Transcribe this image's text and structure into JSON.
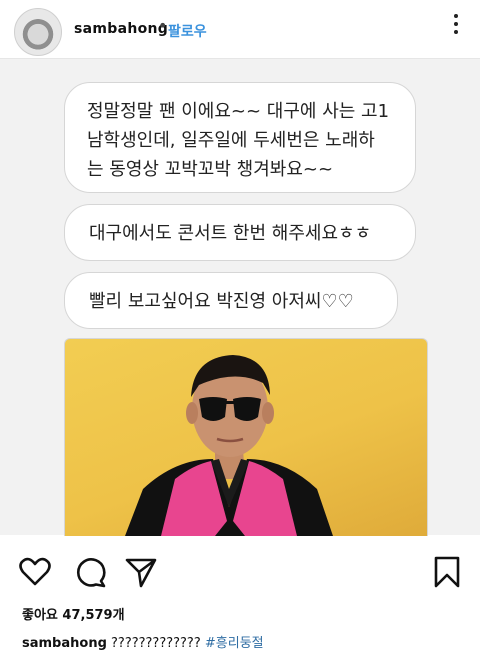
{
  "header": {
    "username": "sambahong",
    "separator": "•",
    "follow_label": "팔로우"
  },
  "post": {
    "messages": [
      [
        "정말정말 팬 이에요~~ 대구에 사는 고1",
        "남학생인데, 일주일에 두세번은 노래하",
        "는 동영상 꼬박꼬박 챙겨봐요~~"
      ],
      [
        "대구에서도 콘서트 한번 해주세요ㅎㅎ"
      ],
      [
        "빨리 보고싶어요 박진영 아저씨♡♡"
      ]
    ]
  },
  "footer": {
    "likes_label": "좋아요",
    "likes_count": "47,579개",
    "caption_user": "sambahong",
    "caption_text": "?????????????",
    "caption_tag": "#흥리둥절"
  },
  "colors": {
    "accent_link": "#3b92dd",
    "hashtag": "#2f6da3",
    "photo_background": "#f2cd52",
    "jacket_pink": "#e8458f"
  },
  "icons": [
    "more-options-icon",
    "heart-icon",
    "comment-icon",
    "share-icon",
    "bookmark-icon"
  ]
}
